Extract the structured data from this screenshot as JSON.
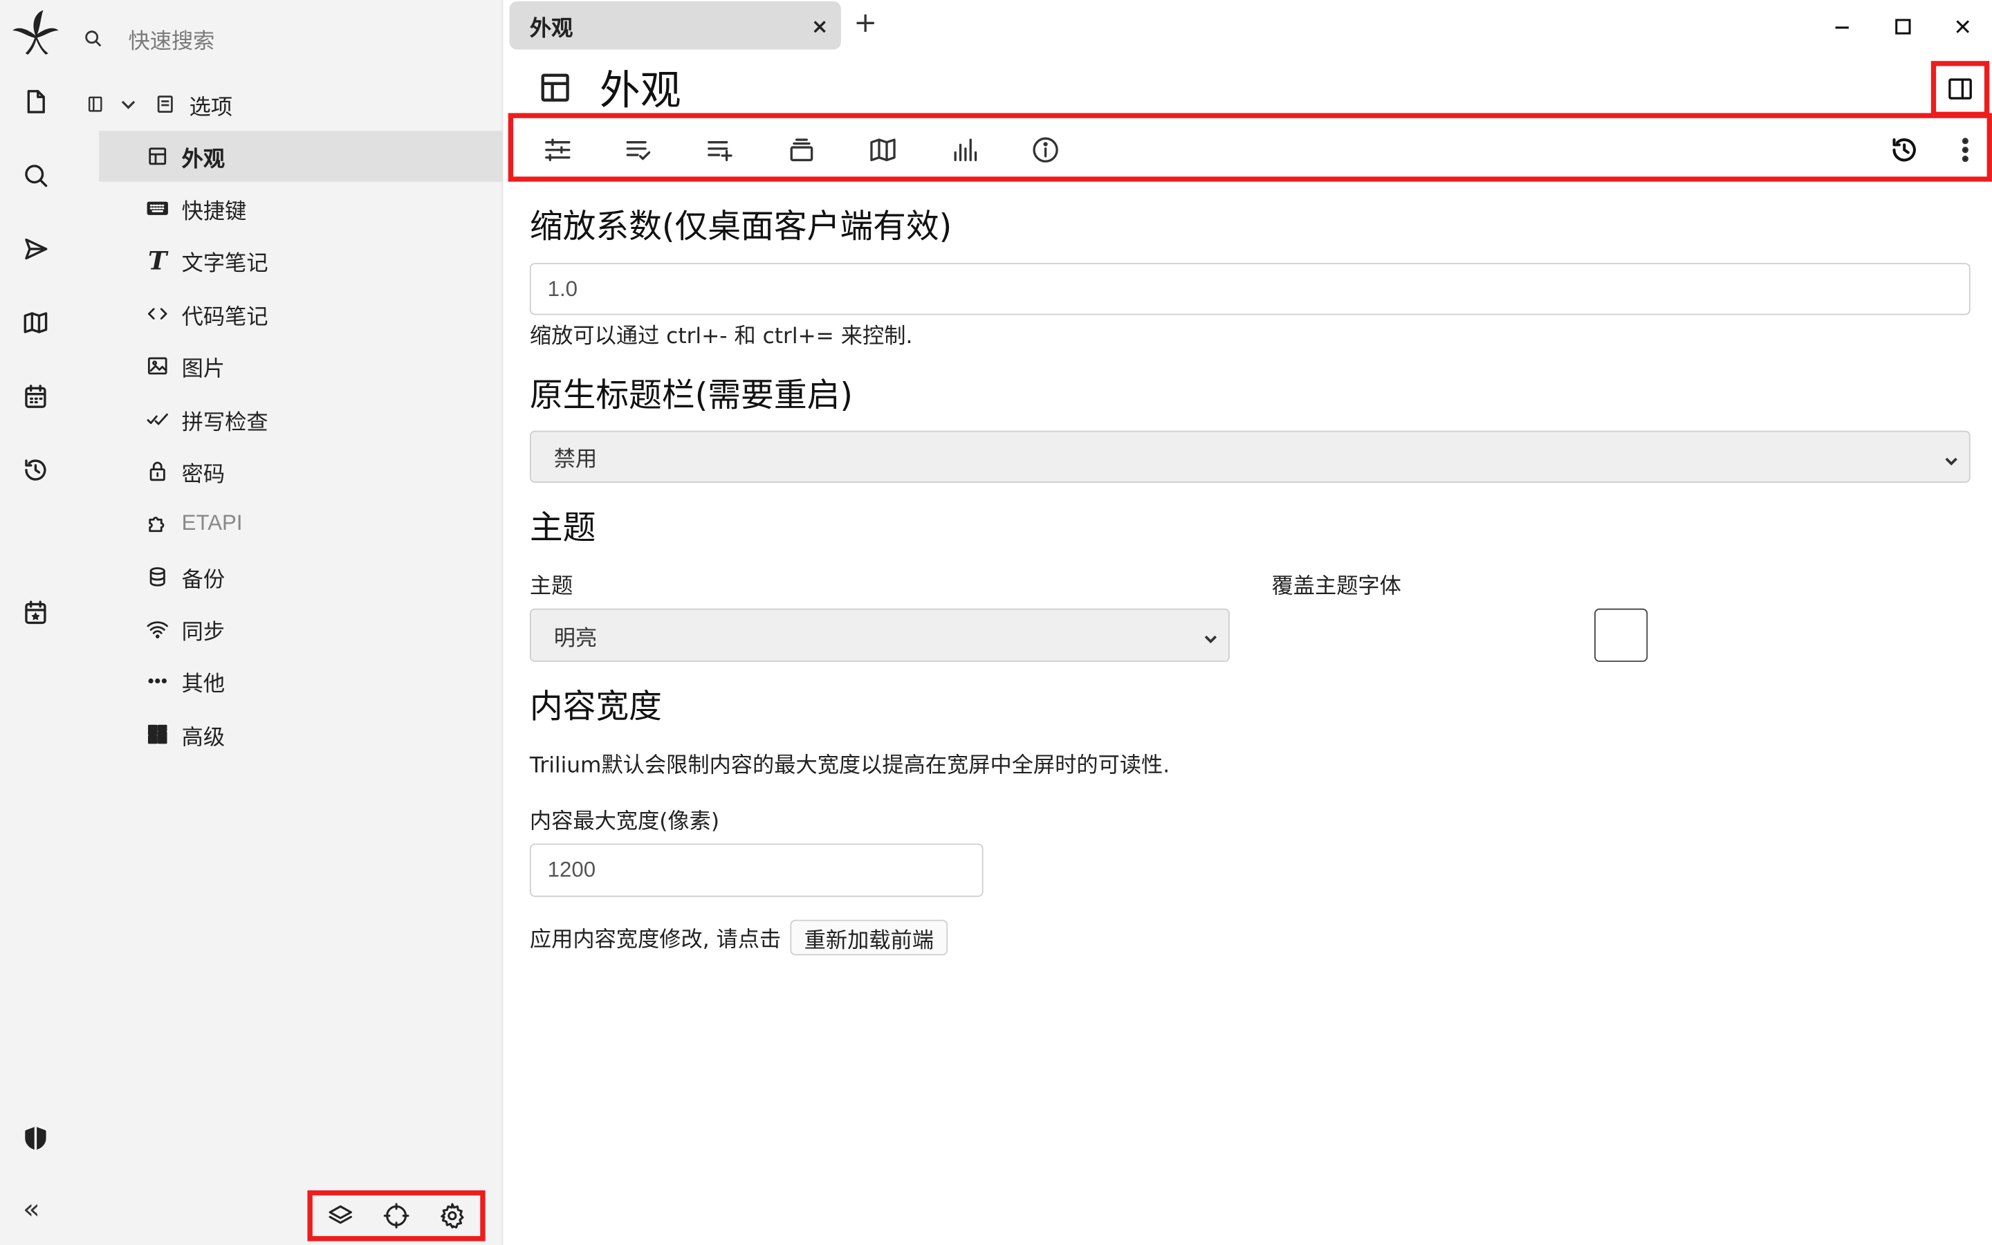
{
  "search": {
    "placeholder": "快速搜索"
  },
  "tree": {
    "root_label": "选项",
    "items": [
      {
        "label": "外观",
        "icon": "layout-icon",
        "active": true
      },
      {
        "label": "快捷键",
        "icon": "keyboard-icon"
      },
      {
        "label": "文字笔记",
        "icon": "text-t-icon"
      },
      {
        "label": "代码笔记",
        "icon": "code-icon"
      },
      {
        "label": "图片",
        "icon": "image-icon"
      },
      {
        "label": "拼写检查",
        "icon": "spellcheck-icon"
      },
      {
        "label": "密码",
        "icon": "lock-icon"
      },
      {
        "label": "ETAPI",
        "icon": "puzzle-icon"
      },
      {
        "label": "备份",
        "icon": "database-icon"
      },
      {
        "label": "同步",
        "icon": "wifi-icon"
      },
      {
        "label": "其他",
        "icon": "dots-icon"
      },
      {
        "label": "高级",
        "icon": "dashboard-icon"
      }
    ]
  },
  "tab": {
    "title": "外观",
    "close": "×",
    "new": "+"
  },
  "note": {
    "title": "外观"
  },
  "sections": {
    "zoom": {
      "heading": "缩放系数(仅桌面客户端有效)",
      "value": "1.0",
      "help": "缩放可以通过 ctrl+- 和 ctrl+= 来控制."
    },
    "titlebar": {
      "heading": "原生标题栏(需要重启)",
      "selected": "禁用"
    },
    "theme": {
      "heading": "主题",
      "theme_label": "主题",
      "theme_selected": "明亮",
      "override_label": "覆盖主题字体",
      "override_checked": false
    },
    "width": {
      "heading": "内容宽度",
      "description": "Trilium默认会限制内容的最大宽度以提高在宽屏中全屏时的可读性.",
      "max_label": "内容最大宽度(像素)",
      "max_value": "1200",
      "apply_text": "应用内容宽度修改, 请点击",
      "reload_button": "重新加载前端"
    }
  },
  "colors": {
    "highlight": "#ee1c1c",
    "sidebar_bg": "#f3f3f3",
    "active_bg": "#e0e0e0"
  }
}
